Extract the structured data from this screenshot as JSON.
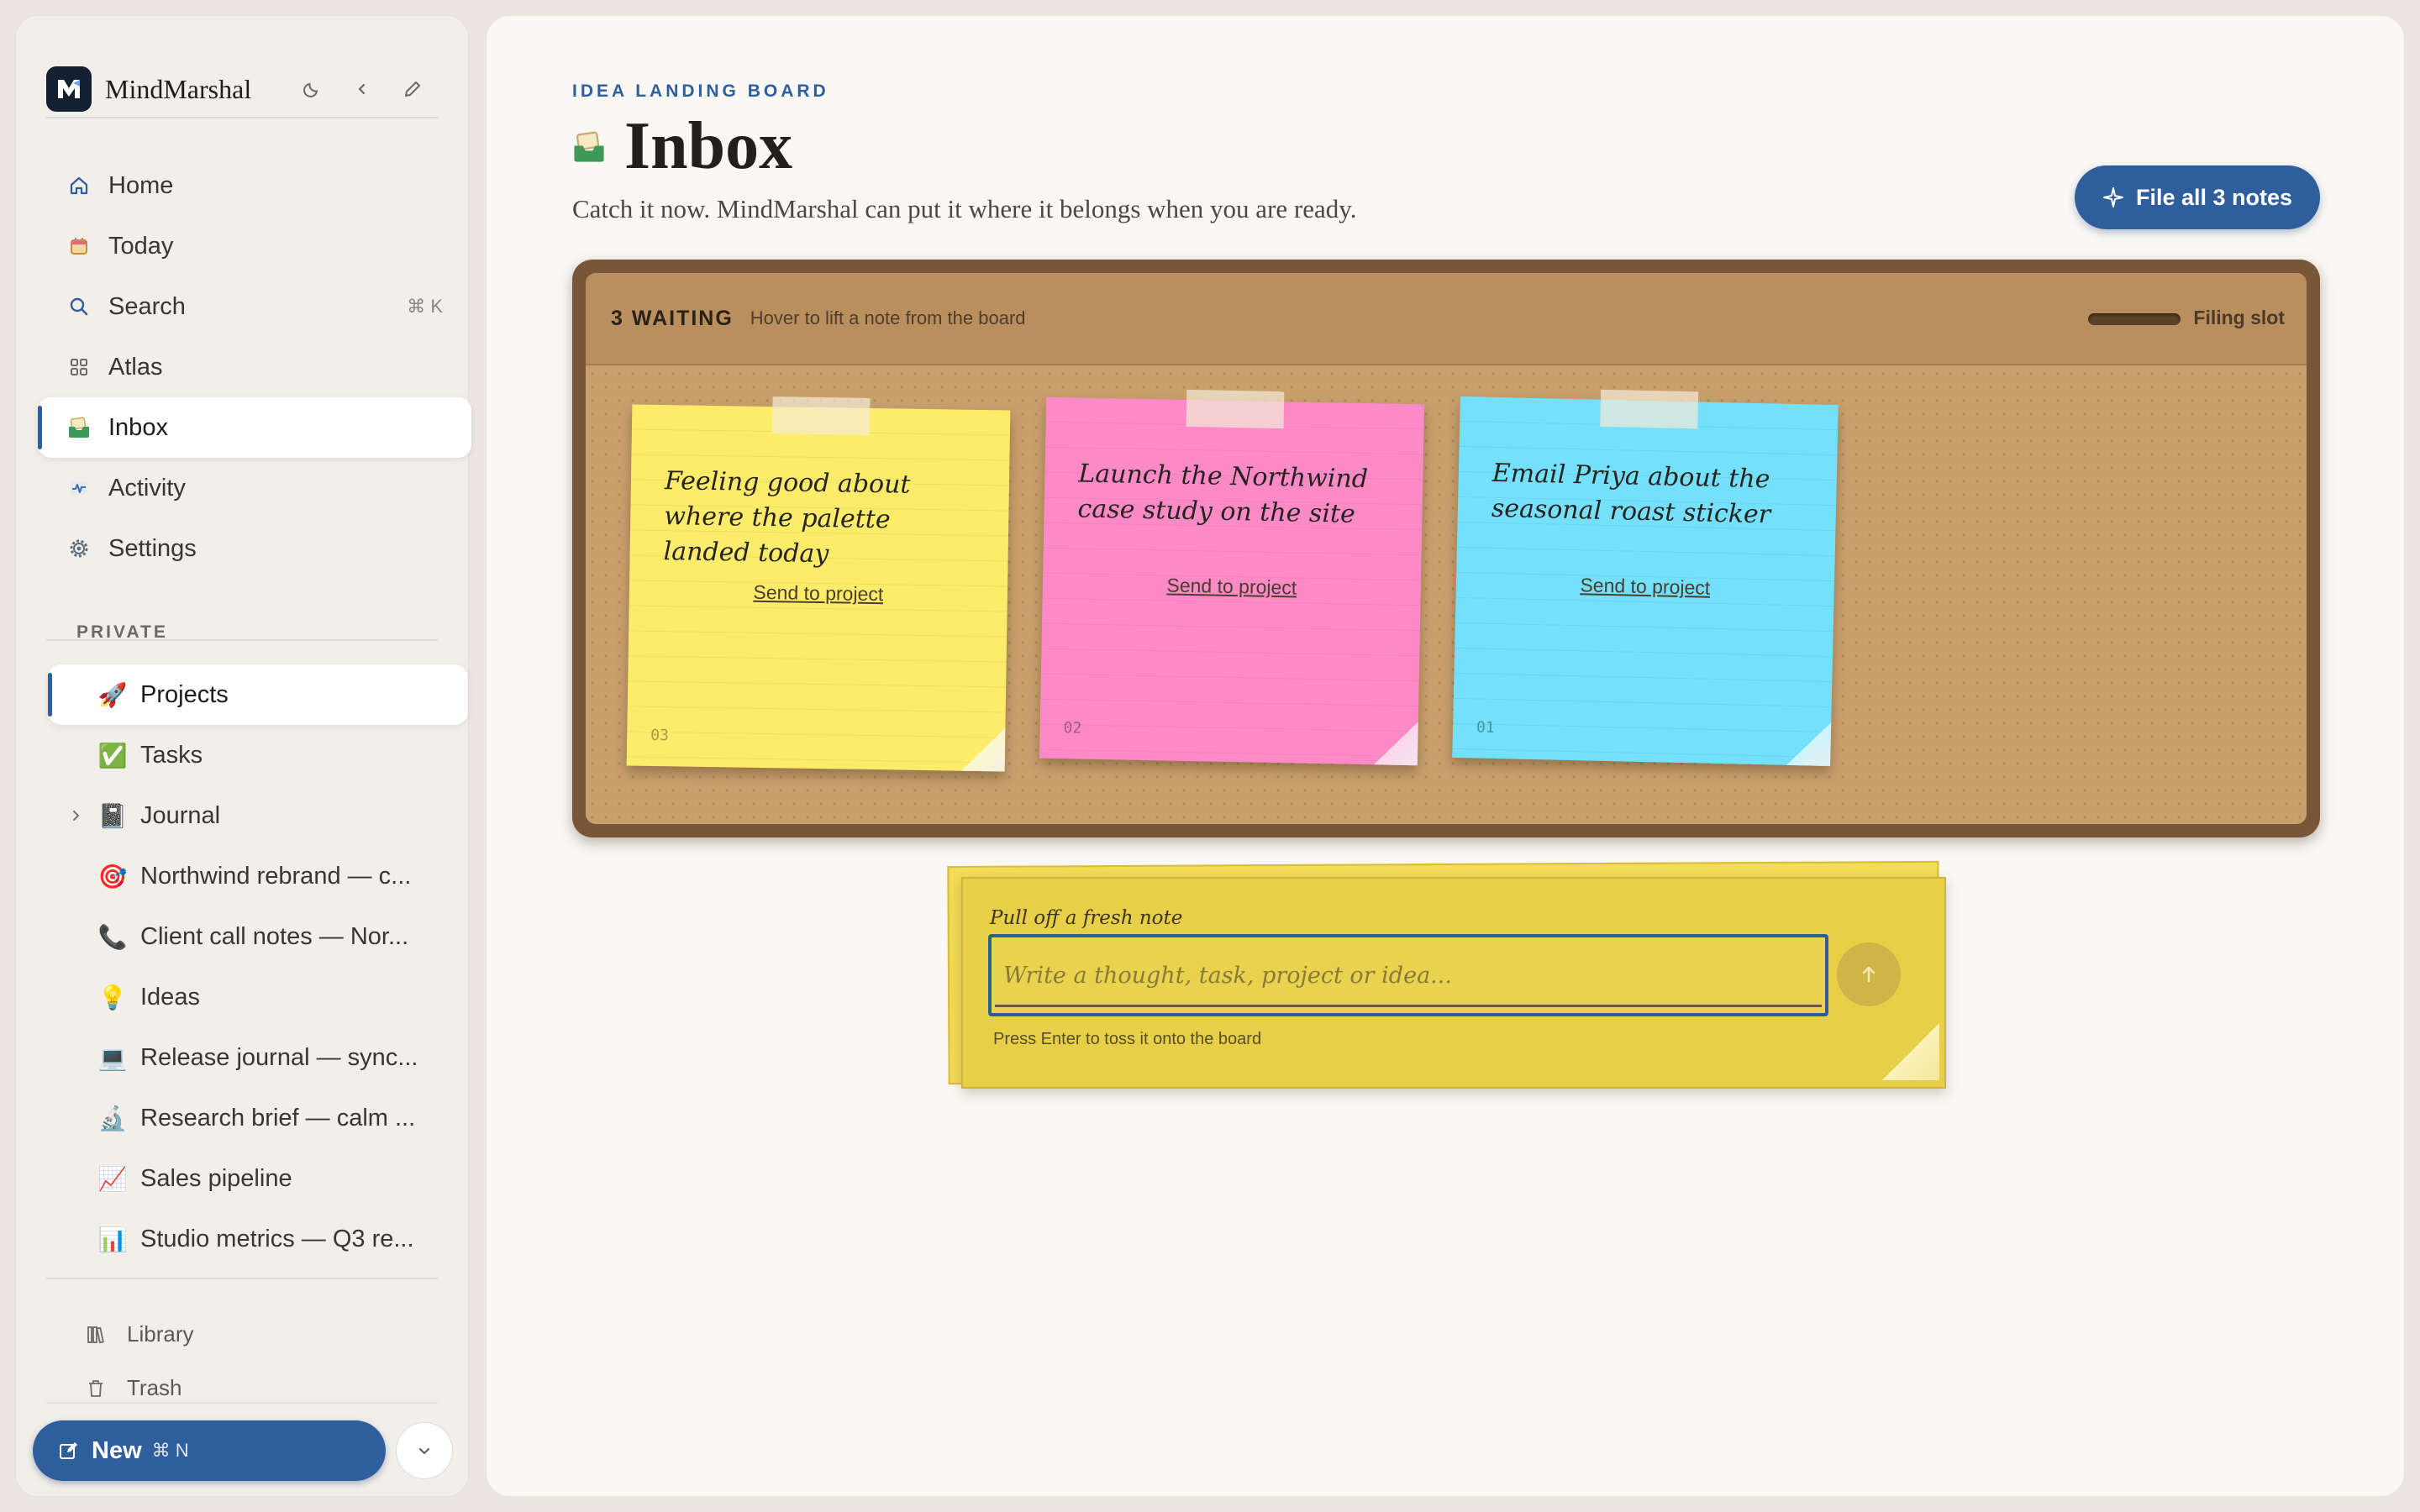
{
  "app": {
    "name": "MindMarshal"
  },
  "sidebar": {
    "nav": [
      {
        "label": "Home",
        "icon": "home-icon"
      },
      {
        "label": "Today",
        "icon": "calendar-icon"
      },
      {
        "label": "Search",
        "icon": "search-icon",
        "shortcut": "⌘ K"
      },
      {
        "label": "Atlas",
        "icon": "grid-icon"
      },
      {
        "label": "Inbox",
        "icon": "inbox-tray-icon",
        "active": true
      },
      {
        "label": "Activity",
        "icon": "activity-icon"
      },
      {
        "label": "Settings",
        "icon": "gear-icon"
      }
    ],
    "section_label": "PRIVATE",
    "pages": [
      {
        "label": "Projects",
        "emoji": "🚀",
        "active": true
      },
      {
        "label": "Tasks",
        "emoji": "✅"
      },
      {
        "label": "Journal",
        "emoji": "📓",
        "expandable": true
      },
      {
        "label": "Northwind rebrand — c...",
        "emoji": "🎯"
      },
      {
        "label": "Client call notes — Nor...",
        "emoji": "📞"
      },
      {
        "label": "Ideas",
        "emoji": "💡"
      },
      {
        "label": "Release journal — sync...",
        "emoji": "💻"
      },
      {
        "label": "Research brief — calm ...",
        "emoji": "🔬"
      },
      {
        "label": "Sales pipeline",
        "emoji": "📈"
      },
      {
        "label": "Studio metrics — Q3 re...",
        "emoji": "📊"
      }
    ],
    "footer": [
      {
        "label": "Library",
        "icon": "library-icon"
      },
      {
        "label": "Trash",
        "icon": "trash-icon"
      }
    ],
    "new_button": {
      "label": "New",
      "shortcut": "⌘ N"
    }
  },
  "main": {
    "eyebrow": "IDEA LANDING BOARD",
    "title": "Inbox",
    "subtitle": "Catch it now. MindMarshal can put it where it belongs when you are ready.",
    "file_all_label": "File all 3 notes",
    "board": {
      "waiting_label": "3 WAITING",
      "hint": "Hover to lift a note from the board",
      "slot_label": "Filing slot",
      "notes": [
        {
          "text": "Feeling good about where the palette landed today",
          "action": "Send to project",
          "number": "03",
          "color": "#fdec6a"
        },
        {
          "text": "Launch the Northwind case study on the site",
          "action": "Send to project",
          "number": "02",
          "color": "#fb8ac6"
        },
        {
          "text": "Email Priya about the seasonal roast sticker",
          "action": "Send to project",
          "number": "01",
          "color": "#74e0fb"
        }
      ]
    },
    "composer": {
      "label": "Pull off a fresh note",
      "placeholder": "Write a thought, task, project or idea...",
      "value": "",
      "hint": "Press Enter to toss it onto the board"
    }
  },
  "colors": {
    "accent": "#2f5e9c",
    "board_frame": "#7a5638",
    "cork": "#c8a06c"
  }
}
